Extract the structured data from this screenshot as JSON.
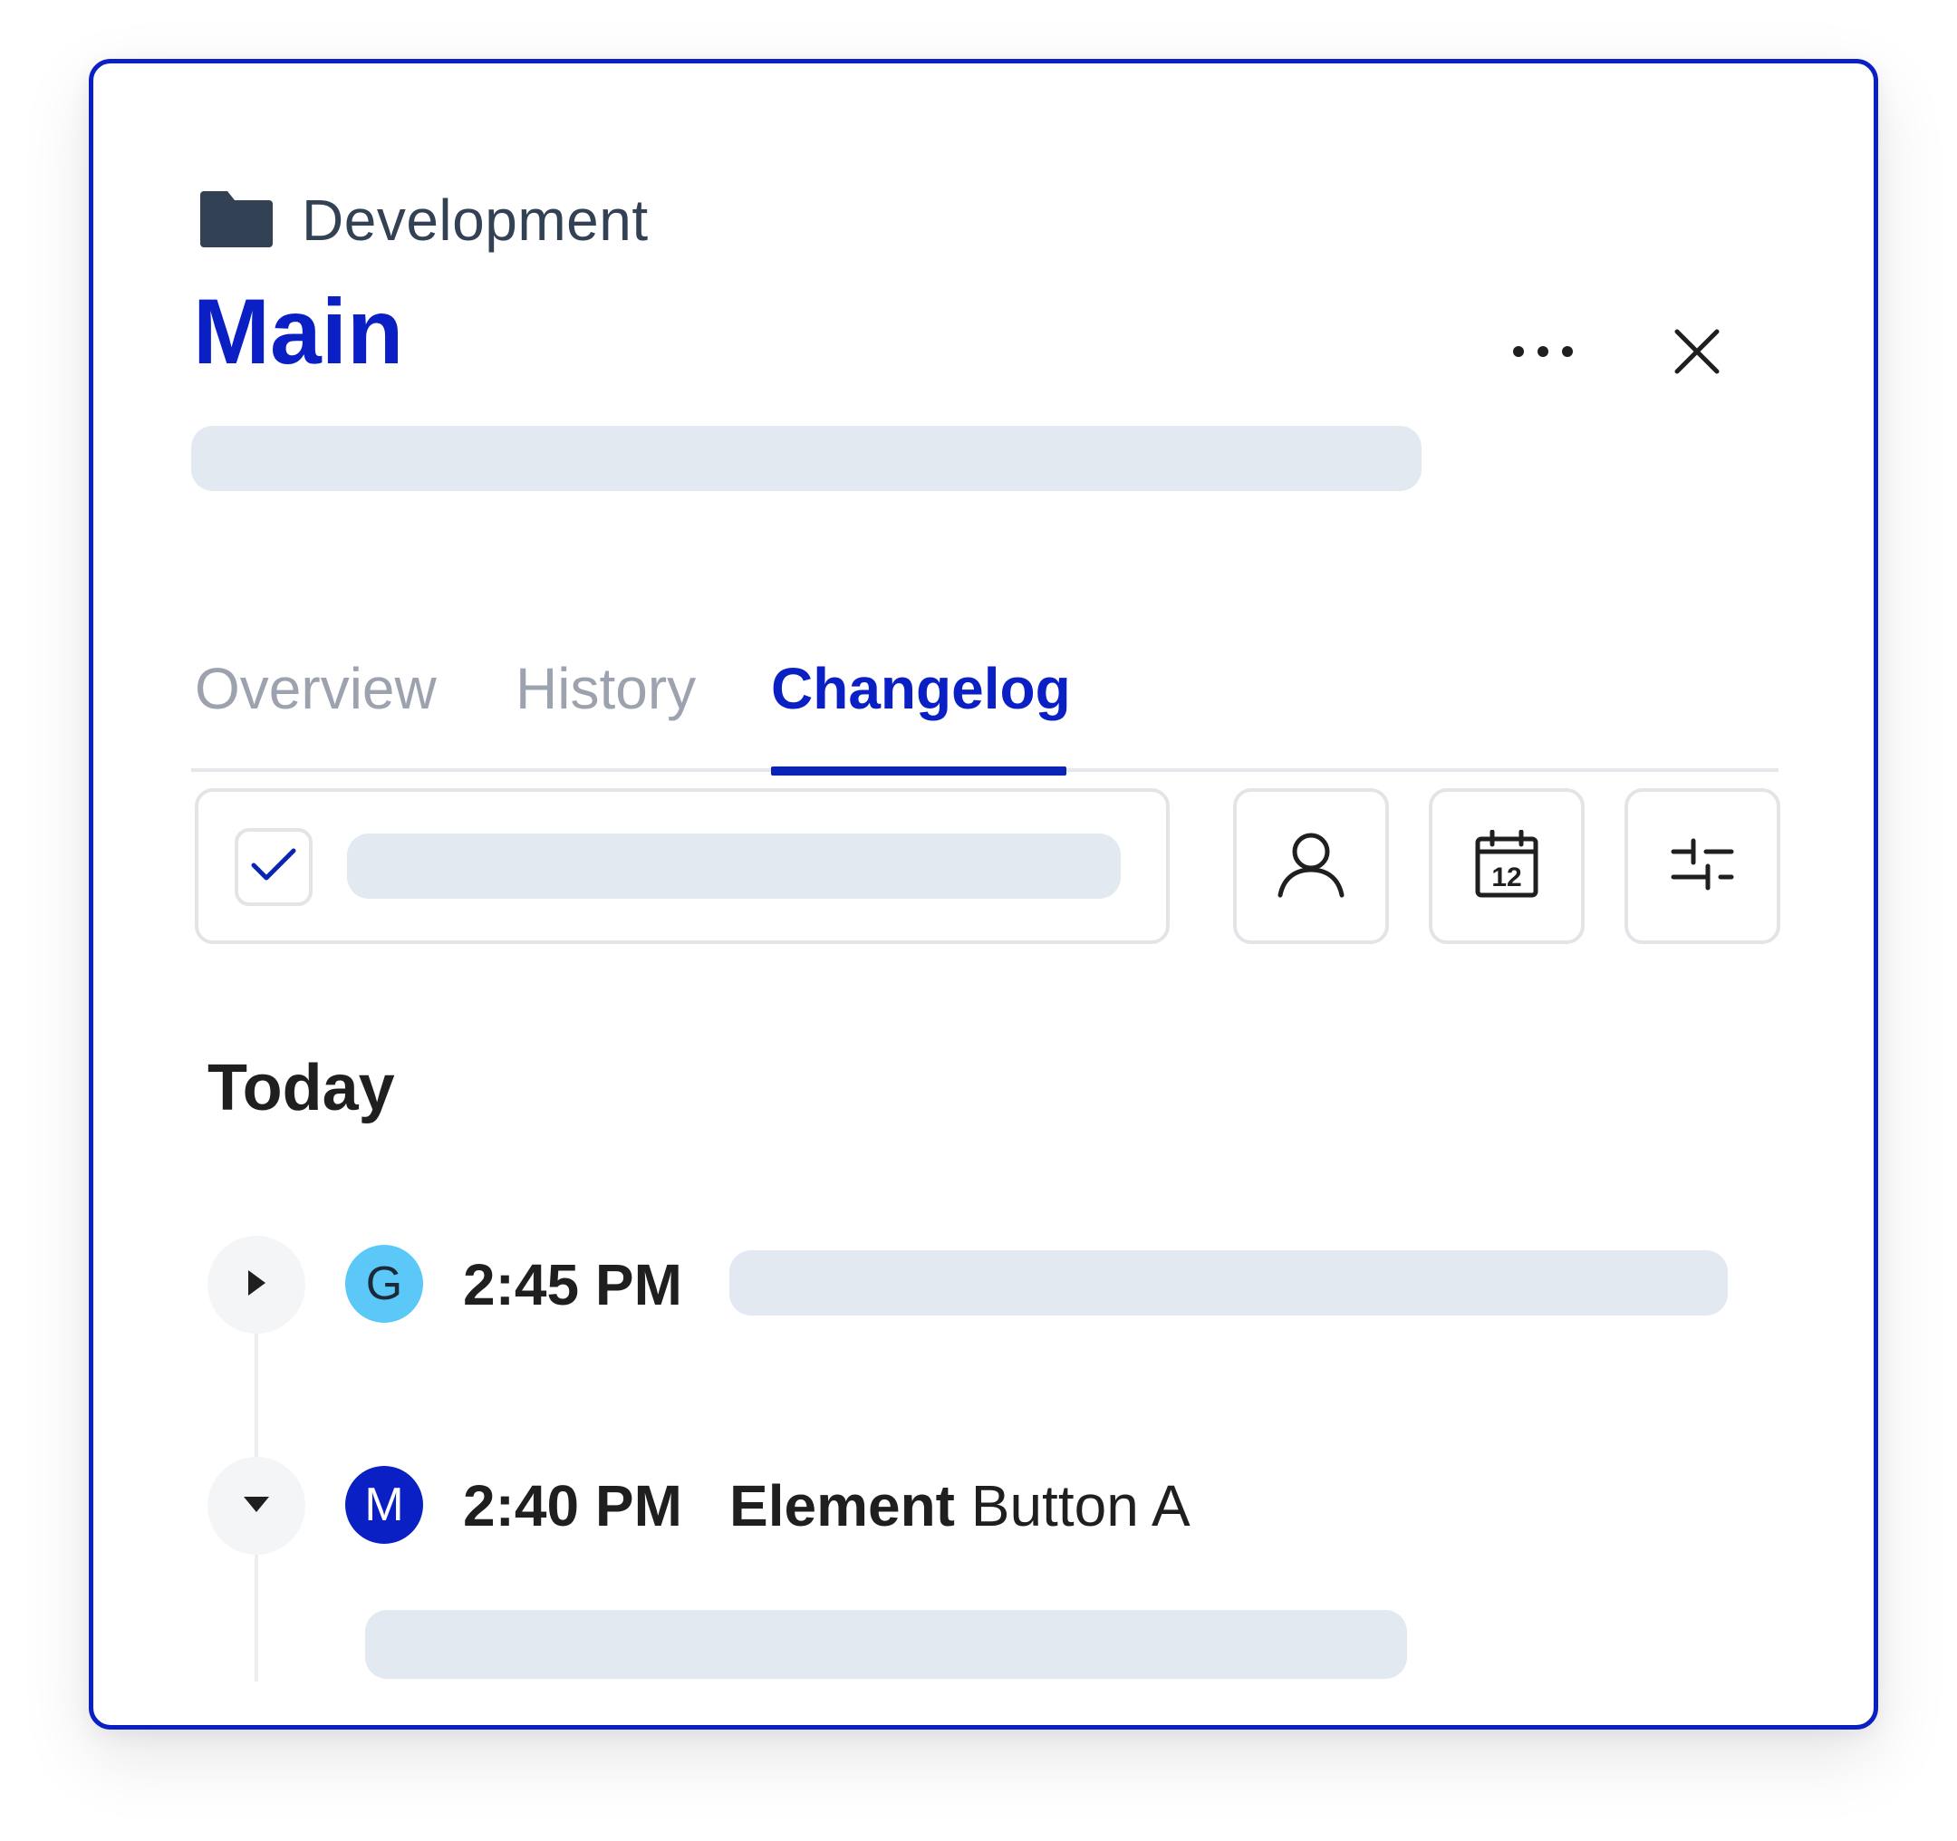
{
  "breadcrumb": {
    "label": "Development",
    "icon": "folder-icon"
  },
  "header": {
    "title": "Main",
    "more_icon": "more-horizontal-icon",
    "close_icon": "close-icon"
  },
  "tabs": [
    {
      "label": "Overview",
      "active": false
    },
    {
      "label": "History",
      "active": false
    },
    {
      "label": "Changelog",
      "active": true
    }
  ],
  "toolbar": {
    "checkbox_checked": true,
    "buttons": [
      "user-icon",
      "calendar-icon",
      "sliders-icon"
    ],
    "calendar_day": "12"
  },
  "section": {
    "heading": "Today"
  },
  "entries": [
    {
      "expanded": false,
      "avatar_letter": "G",
      "time": "2:45 PM"
    },
    {
      "expanded": true,
      "avatar_letter": "M",
      "time": "2:40 PM",
      "type": "Element",
      "target": "Button A"
    }
  ],
  "colors": {
    "accent": "#0a1fc4",
    "skeleton": "#e3e9f1",
    "avatar_g": "#5cc8f8",
    "avatar_m": "#0a1fc4",
    "text": "#1f1f1f",
    "muted": "#9ca3af"
  }
}
